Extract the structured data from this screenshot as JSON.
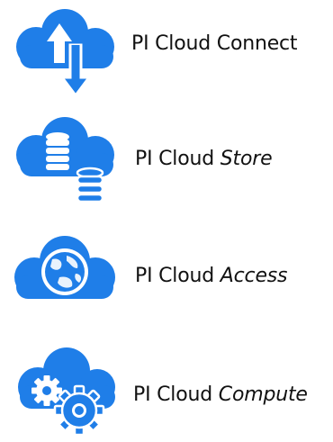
{
  "colors": {
    "cloud": "#1f7ee8",
    "white": "#ffffff",
    "text": "#111111"
  },
  "items": [
    {
      "prefix": "PI Cloud",
      "suffix": "Connect",
      "suffix_italic": false,
      "icon": "cloud-upload-download-icon"
    },
    {
      "prefix": "PI Cloud",
      "suffix": "Store",
      "suffix_italic": true,
      "icon": "cloud-database-icon"
    },
    {
      "prefix": "PI Cloud",
      "suffix": "Access",
      "suffix_italic": true,
      "icon": "cloud-globe-icon"
    },
    {
      "prefix": "PI Cloud",
      "suffix": "Compute",
      "suffix_italic": true,
      "icon": "cloud-gears-icon"
    }
  ]
}
